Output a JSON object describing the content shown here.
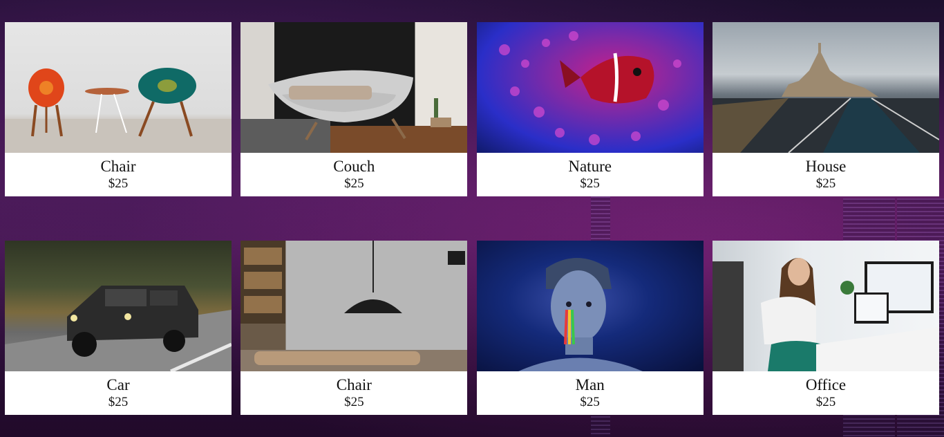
{
  "products": [
    {
      "title": "Chair",
      "price": "$25",
      "image_icon": "chairs-photo"
    },
    {
      "title": "Couch",
      "price": "$25",
      "image_icon": "couch-photo"
    },
    {
      "title": "Nature",
      "price": "$25",
      "image_icon": "fish-photo"
    },
    {
      "title": "House",
      "price": "$25",
      "image_icon": "castle-photo"
    },
    {
      "title": "Car",
      "price": "$25",
      "image_icon": "car-photo"
    },
    {
      "title": "Chair",
      "price": "$25",
      "image_icon": "lamp-room-photo"
    },
    {
      "title": "Man",
      "price": "$25",
      "image_icon": "man-photo"
    },
    {
      "title": "Office",
      "price": "$25",
      "image_icon": "office-photo"
    }
  ],
  "colors": {
    "card_background": "#ffffff",
    "text": "#111111",
    "page_background": "#3a1646"
  }
}
